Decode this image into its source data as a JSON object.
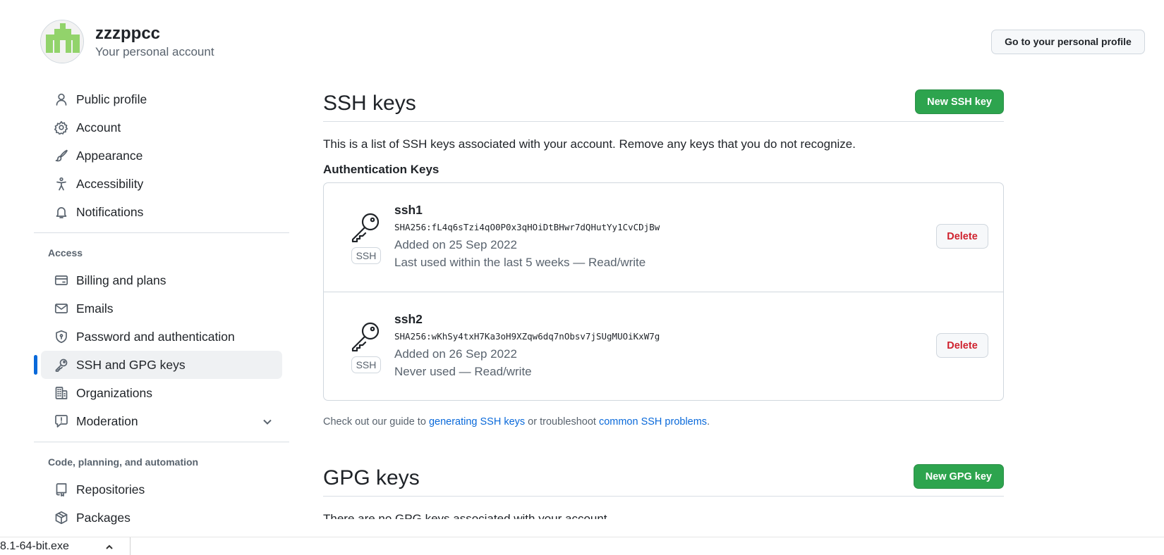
{
  "account": {
    "name": "zzzppcc",
    "subtitle": "Your personal account",
    "profile_button": "Go to your personal profile"
  },
  "sidebar": {
    "items_top": [
      {
        "label": "Public profile",
        "icon": "person-icon"
      },
      {
        "label": "Account",
        "icon": "gear-icon"
      },
      {
        "label": "Appearance",
        "icon": "paintbrush-icon"
      },
      {
        "label": "Accessibility",
        "icon": "accessibility-icon"
      },
      {
        "label": "Notifications",
        "icon": "bell-icon"
      }
    ],
    "access_heading": "Access",
    "items_access": [
      {
        "label": "Billing and plans",
        "icon": "credit-card-icon"
      },
      {
        "label": "Emails",
        "icon": "mail-icon"
      },
      {
        "label": "Password and authentication",
        "icon": "shield-lock-icon"
      },
      {
        "label": "SSH and GPG keys",
        "icon": "key-icon",
        "active": true
      },
      {
        "label": "Organizations",
        "icon": "organization-icon"
      },
      {
        "label": "Moderation",
        "icon": "report-icon"
      }
    ],
    "code_heading": "Code, planning, and automation",
    "items_code": [
      {
        "label": "Repositories",
        "icon": "repo-icon"
      },
      {
        "label": "Packages",
        "icon": "package-icon"
      }
    ]
  },
  "ssh": {
    "title": "SSH keys",
    "new_button": "New SSH key",
    "intro": "This is a list of SSH keys associated with your account. Remove any keys that you do not recognize.",
    "auth_heading": "Authentication Keys",
    "keys": [
      {
        "name": "ssh1",
        "badge": "SSH",
        "fingerprint": "SHA256:fL4q6sTzi4qO0P0x3qHOiDtBHwr7dQHutYy1CvCDjBw",
        "added": "Added on 25 Sep 2022",
        "usage": "Last used within the last 5 weeks — Read/write",
        "delete_label": "Delete"
      },
      {
        "name": "ssh2",
        "badge": "SSH",
        "fingerprint": "SHA256:wKhSy4txH7Ka3oH9XZqw6dq7nObsv7jSUgMUOiKxW7g",
        "added": "Added on 26 Sep 2022",
        "usage": "Never used — Read/write",
        "delete_label": "Delete"
      }
    ],
    "guide_prefix": "Check out our guide to ",
    "guide_link1": "generating SSH keys",
    "guide_middle": " or troubleshoot ",
    "guide_link2": "common SSH problems",
    "guide_suffix": "."
  },
  "gpg": {
    "title": "GPG keys",
    "new_button": "New GPG key",
    "intro": "There are no GPG keys associated with your account."
  },
  "download_bar": {
    "filename": "8.1-64-bit.exe"
  }
}
